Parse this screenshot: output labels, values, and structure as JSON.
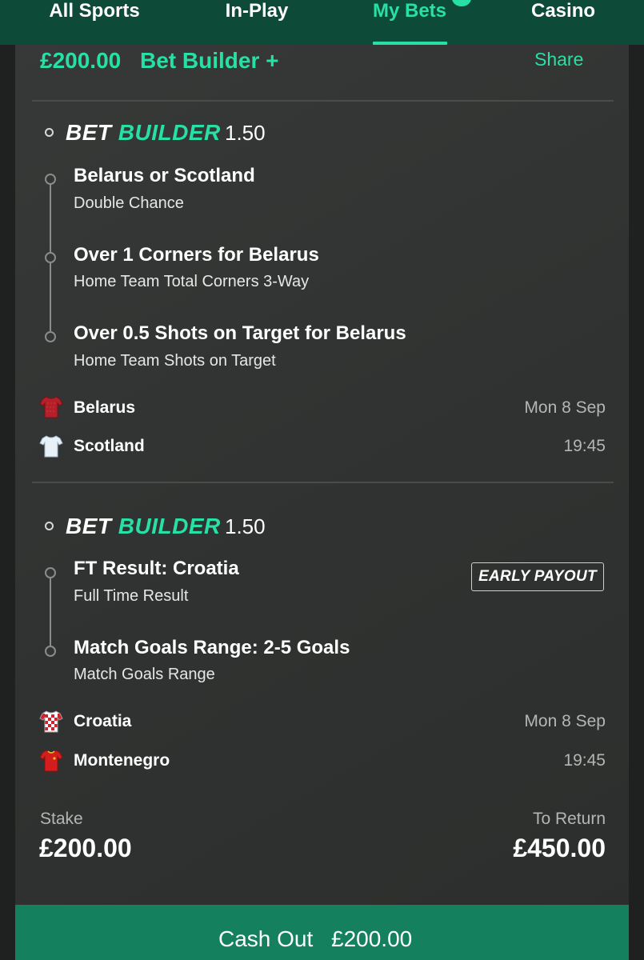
{
  "nav": {
    "tabs": [
      "All Sports",
      "In-Play",
      "My Bets",
      "Casino"
    ],
    "active": "My Bets"
  },
  "bet": {
    "amount": "£200.00",
    "type": "Bet Builder +",
    "share_label": "Share"
  },
  "builder_label": {
    "bet": "BET",
    "builder": "BUILDER"
  },
  "builders": [
    {
      "odds": "1.50",
      "legs": [
        {
          "title": "Belarus or Scotland",
          "market": "Double Chance"
        },
        {
          "title": "Over 1 Corners for Belarus",
          "market": "Home Team Total Corners 3-Way"
        },
        {
          "title": "Over 0.5 Shots on Target for Belarus",
          "market": "Home Team Shots on Target"
        }
      ],
      "home": {
        "name": "Belarus",
        "kit_icon": "red-shirt-icon"
      },
      "away": {
        "name": "Scotland",
        "kit_icon": "white-shirt-icon"
      },
      "date": "Mon 8 Sep",
      "time": "19:45"
    },
    {
      "odds": "1.50",
      "early_payout": "EARLY PAYOUT",
      "legs": [
        {
          "title": "FT Result: Croatia",
          "market": "Full Time Result"
        },
        {
          "title": "Match Goals Range: 2-5 Goals",
          "market": "Match Goals Range"
        }
      ],
      "home": {
        "name": "Croatia",
        "kit_icon": "checkered-shirt-icon"
      },
      "away": {
        "name": "Montenegro",
        "kit_icon": "red-shirt-icon"
      },
      "date": "Mon 8 Sep",
      "time": "19:45"
    }
  ],
  "summary": {
    "stake_label": "Stake",
    "stake": "£200.00",
    "return_label": "To Return",
    "return": "£450.00"
  },
  "cashout": {
    "label": "Cash Out",
    "amount": "£200.00"
  },
  "colors": {
    "accent": "#27e0a5",
    "nav_bg": "#0e4a38",
    "cashout_bg": "#14805e",
    "card_bg": "#343635"
  }
}
